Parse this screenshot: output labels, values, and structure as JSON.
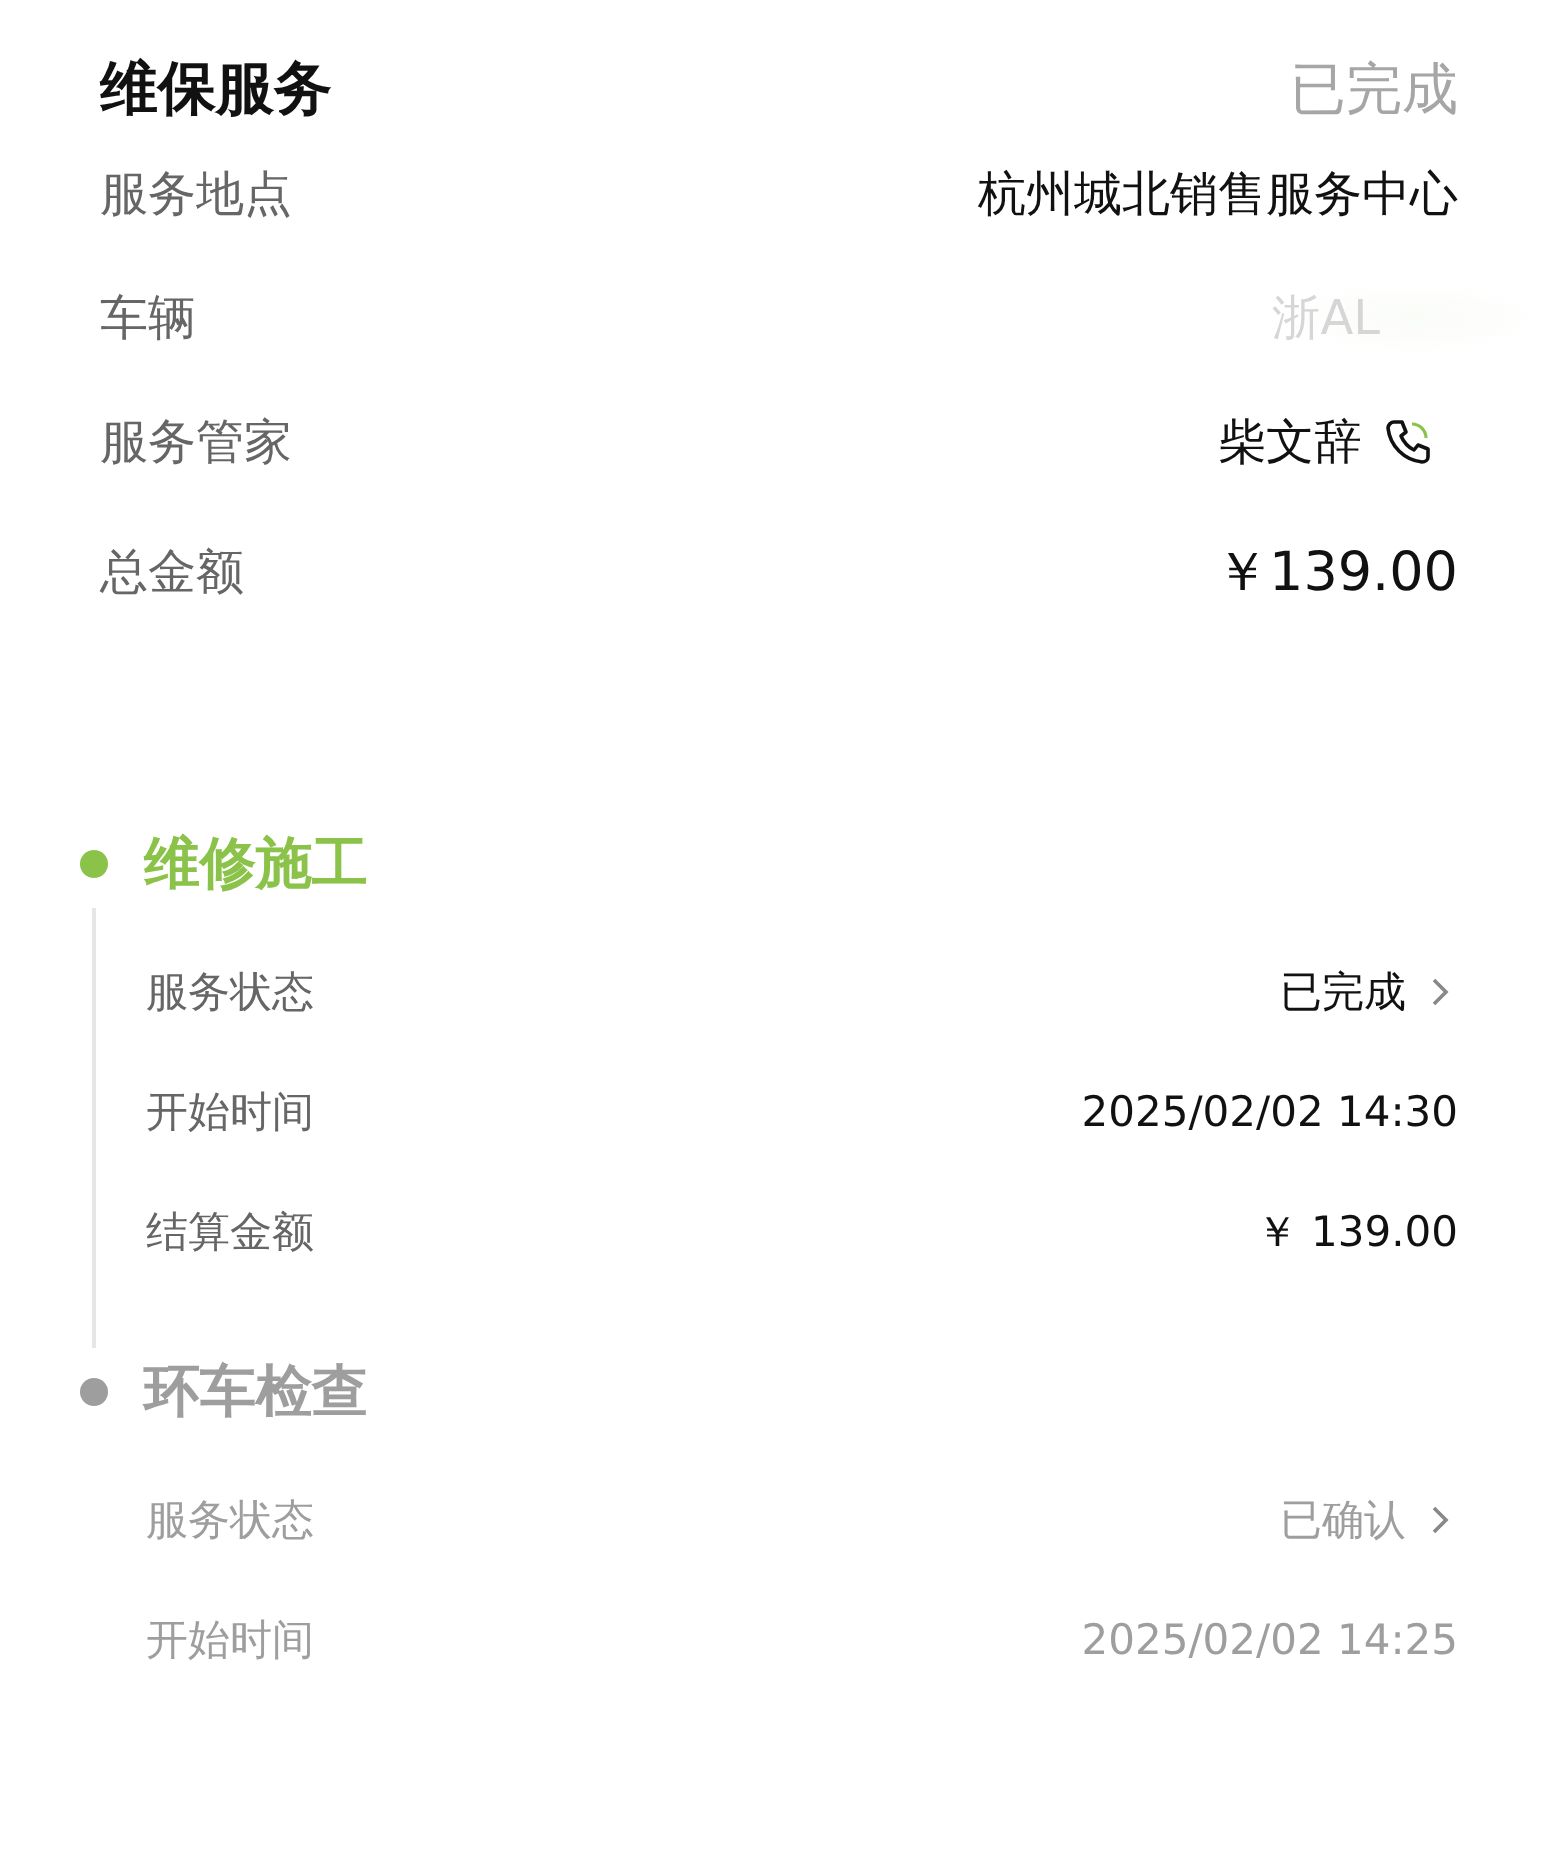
{
  "header": {
    "title": "维保服务",
    "status": "已完成"
  },
  "info": [
    {
      "label": "服务地点",
      "value": "杭州城北销售服务中心",
      "kind": "text"
    },
    {
      "label": "车辆",
      "value": "浙AL",
      "kind": "masked"
    },
    {
      "label": "服务管家",
      "value": "柴文辞",
      "kind": "phone"
    },
    {
      "label": "总金额",
      "value": "￥139.00",
      "kind": "amount"
    }
  ],
  "stages": [
    {
      "title": "维修施工",
      "active": true,
      "rows": [
        {
          "label": "服务状态",
          "value": "已完成",
          "kind": "link"
        },
        {
          "label": "开始时间",
          "value": "2025/02/02 14:30",
          "kind": "text"
        },
        {
          "label": "结算金额",
          "value": "￥ 139.00",
          "kind": "text"
        }
      ]
    },
    {
      "title": "环车检查",
      "active": false,
      "rows": [
        {
          "label": "服务状态",
          "value": "已确认",
          "kind": "link"
        },
        {
          "label": "开始时间",
          "value": "2025/02/02 14:25",
          "kind": "text"
        }
      ]
    }
  ]
}
